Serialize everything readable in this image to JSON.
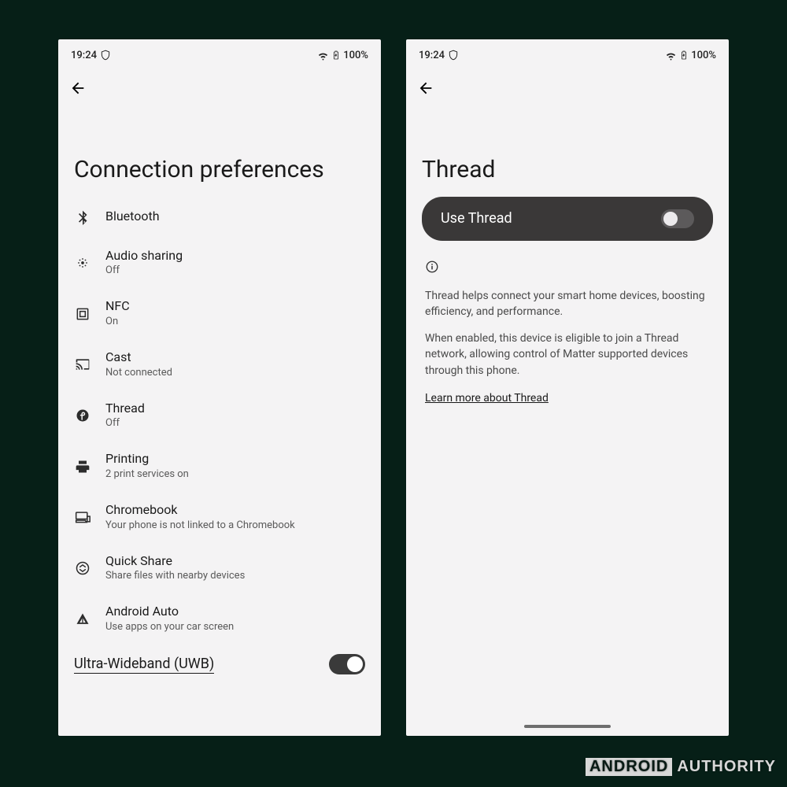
{
  "status": {
    "time": "19:24",
    "battery": "100%"
  },
  "left": {
    "title": "Connection preferences",
    "items": [
      {
        "icon": "bluetooth",
        "title": "Bluetooth",
        "sub": ""
      },
      {
        "icon": "audioshare",
        "title": "Audio sharing",
        "sub": "Off"
      },
      {
        "icon": "nfc",
        "title": "NFC",
        "sub": "On"
      },
      {
        "icon": "cast",
        "title": "Cast",
        "sub": "Not connected"
      },
      {
        "icon": "thread",
        "title": "Thread",
        "sub": "Off"
      },
      {
        "icon": "print",
        "title": "Printing",
        "sub": "2 print services on"
      },
      {
        "icon": "chromebook",
        "title": "Chromebook",
        "sub": "Your phone is not linked to a Chromebook"
      },
      {
        "icon": "quickshare",
        "title": "Quick Share",
        "sub": "Share files with nearby devices"
      },
      {
        "icon": "androidauto",
        "title": "Android Auto",
        "sub": "Use apps on your car screen"
      }
    ],
    "uwb_label": "Ultra-Wideband (UWB)"
  },
  "right": {
    "title": "Thread",
    "pill_label": "Use Thread",
    "info_p1": "Thread helps connect your smart home devices, boosting efficiency, and performance.",
    "info_p2": "When enabled, this device is eligible to join a Thread network, allowing control of Matter supported devices through this phone.",
    "learn_more": "Learn more about Thread"
  },
  "watermark": {
    "a": "ANDROID",
    "b": "AUTHORITY"
  }
}
